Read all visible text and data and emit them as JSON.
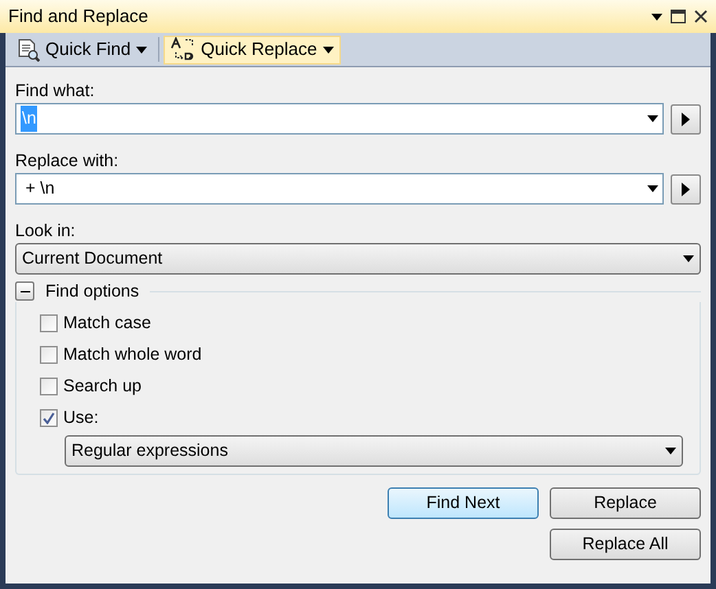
{
  "window": {
    "title": "Find and Replace"
  },
  "toolbar": [
    {
      "label": "Quick Find",
      "kind": "find",
      "selected": false
    },
    {
      "label": "Quick Replace",
      "kind": "replace",
      "selected": true
    }
  ],
  "find_what": {
    "label": "Find what:",
    "value": "\\n"
  },
  "replace_with": {
    "label": "Replace with:",
    "value": " + \\n"
  },
  "look_in": {
    "label": "Look in:",
    "value": "Current Document"
  },
  "find_options": {
    "label": "Find options",
    "expanded": true,
    "options": [
      {
        "label": "Match case",
        "checked": false
      },
      {
        "label": "Match whole word",
        "checked": false
      },
      {
        "label": "Search up",
        "checked": false
      },
      {
        "label": "Use:",
        "checked": true
      }
    ],
    "use_value": "Regular expressions"
  },
  "buttons": [
    {
      "label": "Find Next",
      "selected": true
    },
    {
      "label": "Replace",
      "selected": false
    },
    {
      "label": "Replace All",
      "selected": false
    }
  ]
}
